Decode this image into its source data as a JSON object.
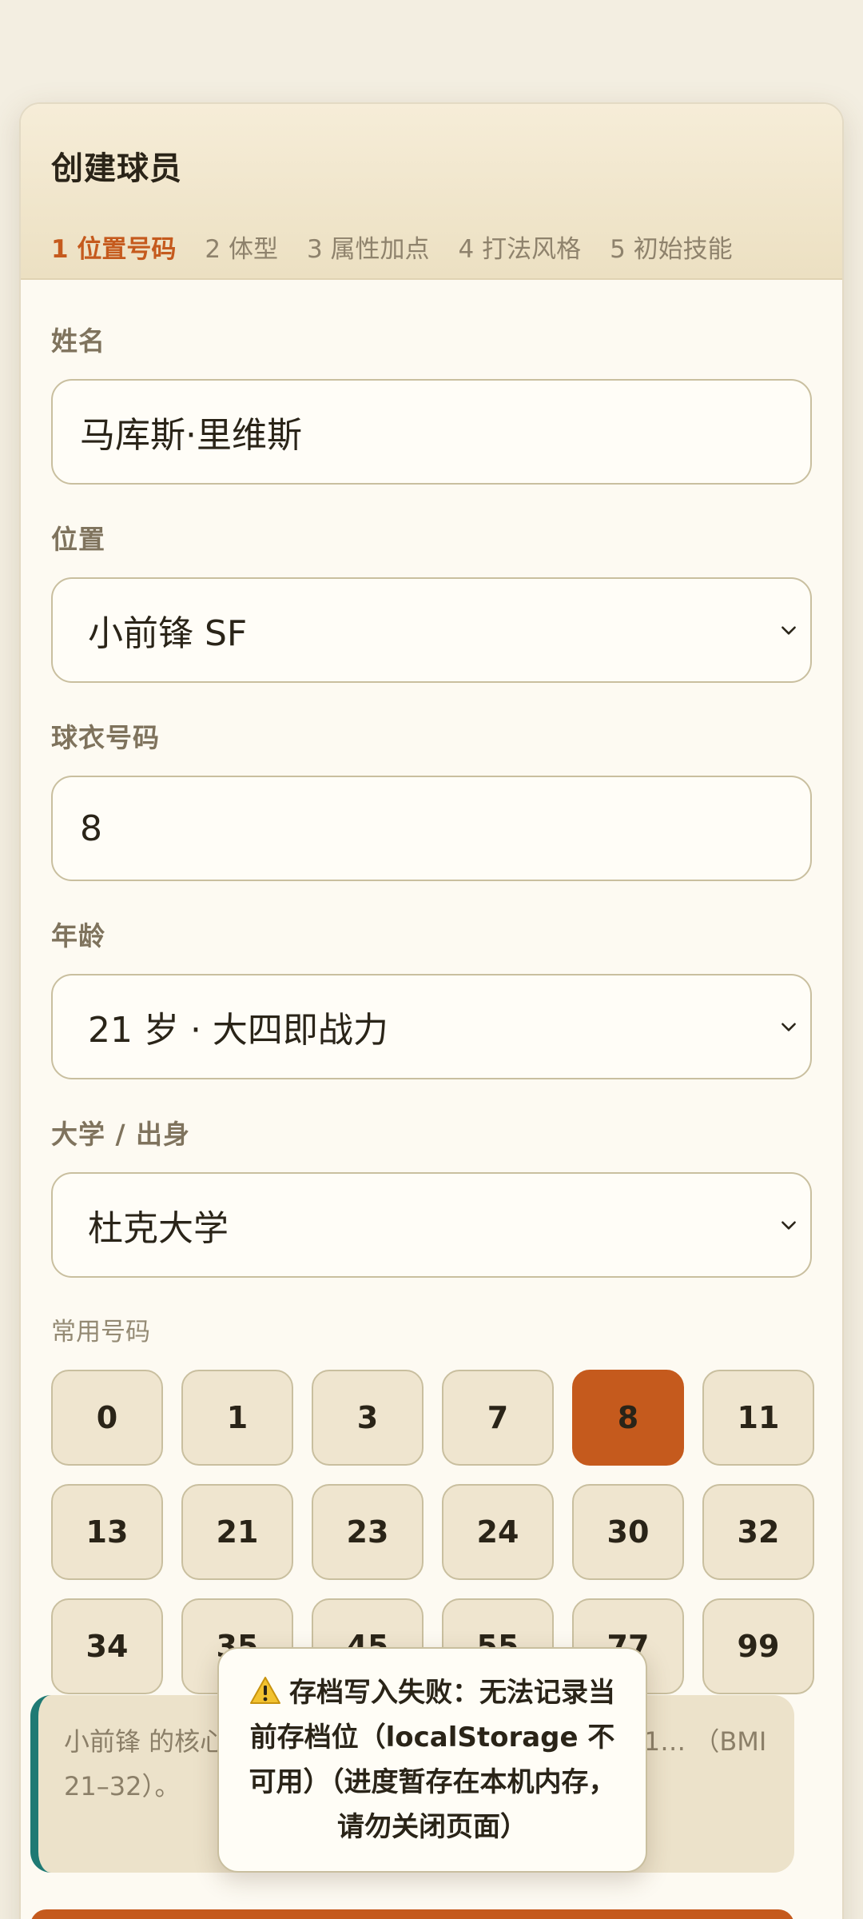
{
  "header": {
    "title": "创建球员",
    "steps": [
      "1 位置号码",
      "2 体型",
      "3 属性加点",
      "4 打法风格",
      "5 初始技能"
    ]
  },
  "form": {
    "name": {
      "label": "姓名",
      "value": "马库斯·里维斯"
    },
    "position": {
      "label": "位置",
      "value": "小前锋 SF"
    },
    "jersey": {
      "label": "球衣号码",
      "value": "8"
    },
    "age": {
      "label": "年龄",
      "value": "21 岁 · 大四即战力"
    },
    "college": {
      "label": "大学 / 出身",
      "value": "杜克大学"
    }
  },
  "common_numbers": {
    "label": "常用号码",
    "numbers": [
      "0",
      "1",
      "3",
      "7",
      "8",
      "11",
      "13",
      "21",
      "23",
      "24",
      "30",
      "32",
      "34",
      "35",
      "45",
      "55",
      "77",
      "99"
    ],
    "selected": "8"
  },
  "info": {
    "text": "小前锋 的核心职责……本位置的身高区间为 195–21… （BMI 21–32）。"
  },
  "toast": {
    "message": "存档写入失败：无法记录当前存档位（localStorage 不可用）（进度暂存在本机内存，请勿关闭页面）"
  },
  "colors": {
    "accent": "#c55a1d",
    "info_border": "#1f7a74",
    "background": "#f3eee1"
  }
}
